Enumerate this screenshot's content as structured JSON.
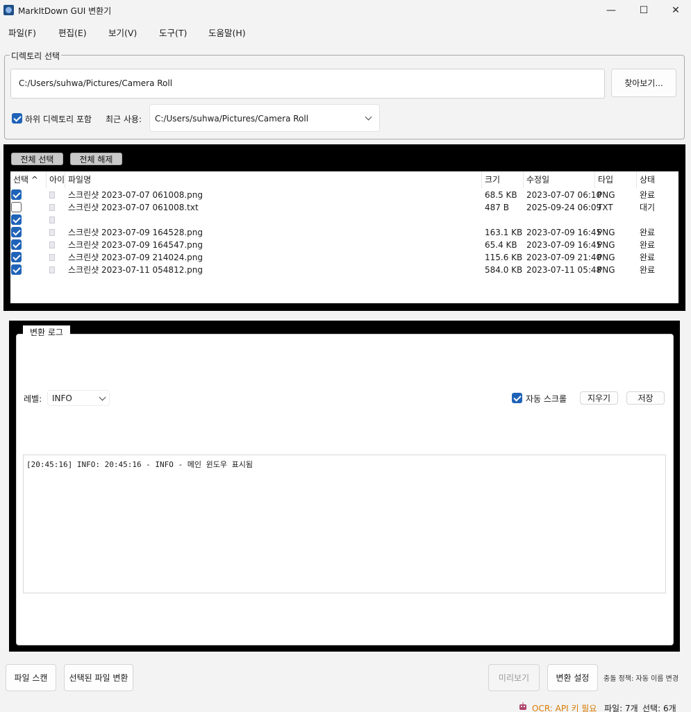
{
  "window": {
    "title": "MarkItDown GUI 변환기",
    "controls": {
      "minimize": "—",
      "maximize": "☐",
      "close": "✕"
    }
  },
  "menu": [
    "파일(F)",
    "편집(E)",
    "보기(V)",
    "도구(T)",
    "도움말(H)"
  ],
  "directory": {
    "group_title": "디렉토리 선택",
    "path": "C:/Users/suhwa/Pictures/Camera Roll",
    "browse_label": "찾아보기...",
    "include_sub_label": "하위 디렉토리 포함",
    "include_sub_checked": true,
    "recent_label": "최근 사용:",
    "recent_value": "C:/Users/suhwa/Pictures/Camera Roll"
  },
  "files": {
    "select_all_label": "전체 선택",
    "deselect_all_label": "전체 해제",
    "columns": [
      "선택 ^",
      "아이",
      "파일명",
      "크기",
      "수정일",
      "타입",
      "상태"
    ],
    "rows": [
      {
        "checked": true,
        "name": "스크린샷 2023-07-07 061008.png",
        "size": "68.5 KB",
        "modified": "2023-07-07 06:10",
        "type": "PNG",
        "status": "완료"
      },
      {
        "checked": false,
        "name": "스크린샷 2023-07-07 061008.txt",
        "size": "487 B",
        "modified": "2025-09-24 06:09",
        "type": "TXT",
        "status": "대기"
      },
      {
        "checked": true,
        "name": "",
        "size": "",
        "modified": "",
        "type": "",
        "status": ""
      },
      {
        "checked": true,
        "name": "스크린샷 2023-07-09 164528.png",
        "size": "163.1 KB",
        "modified": "2023-07-09 16:45",
        "type": "PNG",
        "status": "완료"
      },
      {
        "checked": true,
        "name": "스크린샷 2023-07-09 164547.png",
        "size": "65.4 KB",
        "modified": "2023-07-09 16:45",
        "type": "PNG",
        "status": "완료"
      },
      {
        "checked": true,
        "name": "스크린샷 2023-07-09 214024.png",
        "size": "115.6 KB",
        "modified": "2023-07-09 21:40",
        "type": "PNG",
        "status": "완료"
      },
      {
        "checked": true,
        "name": "스크린샷 2023-07-11 054812.png",
        "size": "584.0 KB",
        "modified": "2023-07-11 05:48",
        "type": "PNG",
        "status": "완료"
      }
    ]
  },
  "log": {
    "group_title": "변환 로그",
    "level_label": "레벨:",
    "level_value": "INFO",
    "auto_scroll_label": "자동 스크롤",
    "auto_scroll_checked": true,
    "clear_label": "지우기",
    "save_label": "저장",
    "lines": [
      "[20:45:16] INFO: 20:45:16 - INFO - 메인 윈도우 표시됨"
    ]
  },
  "bottom": {
    "scan_label": "파일 스캔",
    "convert_label": "선택된 파일 변환",
    "preview_label": "미리보기",
    "settings_label": "변환 설정",
    "conflict_policy": "충돌 정책: 자동 이름 변경"
  },
  "status": {
    "ocr": "OCR: API 키 필요",
    "files": "파일: 7개",
    "selected": "선택: 6개"
  },
  "colors": {
    "accent": "#1f63b8",
    "ocr_warning": "#d97a00"
  }
}
